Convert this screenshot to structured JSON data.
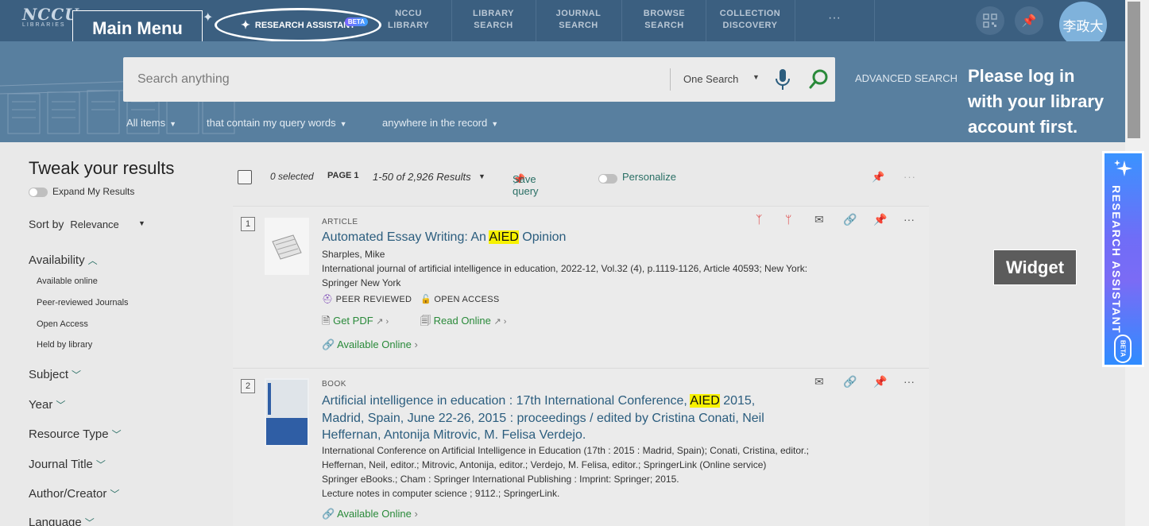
{
  "nav": {
    "logo_text": "NCCU",
    "logo_sub": "LIBRARIES",
    "research_assistant": "RESEARCH ASSISTANT",
    "beta": "BETA",
    "items": [
      {
        "line1": "NCCU",
        "line2": "LIBRARY"
      },
      {
        "line1": "LIBRARY",
        "line2": "SEARCH"
      },
      {
        "line1": "JOURNAL",
        "line2": "SEARCH"
      },
      {
        "line1": "BROWSE",
        "line2": "SEARCH"
      },
      {
        "line1": "COLLECTION",
        "line2": "DISCOVERY"
      }
    ],
    "more": "···",
    "avatar": "李政大"
  },
  "annotations": {
    "main_menu": "Main Menu",
    "login_line1": "Please log in",
    "login_line2": "with your library",
    "login_line3": "account  first.",
    "widget": "Widget"
  },
  "search": {
    "placeholder": "Search anything",
    "scope": "One Search",
    "advanced": "ADVANCED SEARCH",
    "filters": [
      "All items",
      "that contain my query words",
      "anywhere in the record"
    ]
  },
  "facets": {
    "title": "Tweak your results",
    "expand": "Expand My Results",
    "sort_label": "Sort by",
    "sort_value": "Relevance",
    "availability": "Availability",
    "availability_items": [
      "Available online",
      "Peer-reviewed Journals",
      "Open Access",
      "Held by library"
    ],
    "groups": [
      "Subject",
      "Year",
      "Resource Type",
      "Journal Title",
      "Author/Creator",
      "Language"
    ]
  },
  "results_bar": {
    "selected": "0 selected",
    "page": "PAGE 1",
    "range": "1-50 of 2,926 Results",
    "save_query": "Save query",
    "personalize": "Personalize"
  },
  "results": [
    {
      "num": "1",
      "type": "ARTICLE",
      "title_pre": "Automated Essay Writing: An ",
      "title_hl": "AIED",
      "title_post": " Opinion",
      "author": "Sharples, Mike",
      "source1": "International journal of artificial intelligence in education, 2022-12, Vol.32 (4), p.1119-1126, Article 40593; New York:",
      "source2": "Springer New York",
      "peer": "PEER REVIEWED",
      "open": "OPEN ACCESS",
      "pdf": "Get PDF",
      "read": "Read Online",
      "avail": "Available Online"
    },
    {
      "num": "2",
      "type": "BOOK",
      "title_l1_pre": "Artificial intelligence in education : 17th International Conference, ",
      "title_hl": "AIED",
      "title_l1_post": " 2015,",
      "title_l2": "Madrid, Spain, June 22-26, 2015 : proceedings / edited by Cristina Conati, Neil",
      "title_l3": "Heffernan, Antonija Mitrovic, M. Felisa Verdejo.",
      "line1": "International Conference on Artificial Intelligence in Education (17th : 2015 : Madrid, Spain); Conati, Cristina, editor.;",
      "line2": "Heffernan, Neil, editor.; Mitrovic, Antonija, editor.; Verdejo, M. Felisa, editor.; SpringerLink (Online service)",
      "line3": "Springer eBooks.; Cham : Springer International Publishing : Imprint: Springer; 2015.",
      "line4": "Lecture notes in computer science ; 9112.; SpringerLink.",
      "avail": "Available Online"
    }
  ],
  "widget": {
    "text": "RESEARCH ASSISTANT",
    "beta": "BETA"
  },
  "colors": {
    "nav": "#3b5f80",
    "band": "#587f9f",
    "title_link": "#2b5d7e",
    "highlight": "#f7f200",
    "teal": "#2a6f65"
  }
}
